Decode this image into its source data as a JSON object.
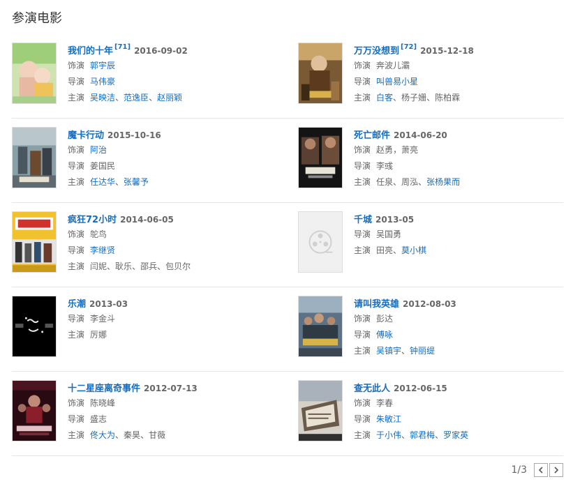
{
  "section": {
    "title": "参演电影"
  },
  "movies": [
    {
      "title": "我们的十年",
      "cite": "[71]",
      "date": "2016-09-02",
      "rows": [
        {
          "label": "饰演",
          "parts": [
            {
              "t": "郭宇辰",
              "link": true
            }
          ]
        },
        {
          "label": "导演",
          "parts": [
            {
              "t": "马伟豪",
              "link": true
            }
          ]
        },
        {
          "label": "主演",
          "parts": [
            {
              "t": "吴映洁",
              "link": true
            },
            {
              "t": "、",
              "link": false
            },
            {
              "t": "范逸臣",
              "link": true
            },
            {
              "t": "、",
              "link": false
            },
            {
              "t": "赵丽颖",
              "link": true
            }
          ]
        }
      ]
    },
    {
      "title": "万万没想到",
      "cite": "[72]",
      "date": "2015-12-18",
      "rows": [
        {
          "label": "饰演",
          "parts": [
            {
              "t": "奔波儿灞",
              "link": false
            }
          ]
        },
        {
          "label": "导演",
          "parts": [
            {
              "t": "叫兽易小星",
              "link": true
            }
          ]
        },
        {
          "label": "主演",
          "parts": [
            {
              "t": "白客",
              "link": true
            },
            {
              "t": "、",
              "link": false
            },
            {
              "t": "杨子姗",
              "link": false
            },
            {
              "t": "、",
              "link": false
            },
            {
              "t": "陈柏霖",
              "link": false
            }
          ]
        }
      ]
    },
    {
      "title": "魔卡行动",
      "cite": "",
      "date": "2015-10-16",
      "rows": [
        {
          "label": "饰演",
          "parts": [
            {
              "t": "阿治",
              "link": true
            }
          ]
        },
        {
          "label": "导演",
          "parts": [
            {
              "t": "姜国民",
              "link": false
            }
          ]
        },
        {
          "label": "主演",
          "parts": [
            {
              "t": "任达华",
              "link": true
            },
            {
              "t": "、",
              "link": false
            },
            {
              "t": "张馨予",
              "link": true
            }
          ]
        }
      ]
    },
    {
      "title": "死亡邮件",
      "cite": "",
      "date": "2014-06-20",
      "rows": [
        {
          "label": "饰演",
          "parts": [
            {
              "t": "赵勇，萧亮",
              "link": false
            }
          ]
        },
        {
          "label": "导演",
          "parts": [
            {
              "t": "李彧",
              "link": false
            }
          ]
        },
        {
          "label": "主演",
          "parts": [
            {
              "t": "任泉",
              "link": false
            },
            {
              "t": "、",
              "link": false
            },
            {
              "t": "周泓",
              "link": false
            },
            {
              "t": "、",
              "link": false
            },
            {
              "t": "张杨果而",
              "link": true
            }
          ]
        }
      ]
    },
    {
      "title": "疯狂72小时",
      "cite": "",
      "date": "2014-06-05",
      "rows": [
        {
          "label": "饰演",
          "parts": [
            {
              "t": "鸵鸟",
              "link": false
            }
          ]
        },
        {
          "label": "导演",
          "parts": [
            {
              "t": "李继贤",
              "link": true
            }
          ]
        },
        {
          "label": "主演",
          "parts": [
            {
              "t": "闫妮",
              "link": false
            },
            {
              "t": "、",
              "link": false
            },
            {
              "t": "耿乐",
              "link": false
            },
            {
              "t": "、",
              "link": false
            },
            {
              "t": "邵兵",
              "link": false
            },
            {
              "t": "、",
              "link": false
            },
            {
              "t": "包贝尔",
              "link": false
            }
          ]
        }
      ]
    },
    {
      "title": "千城",
      "cite": "",
      "date": "2013-05",
      "rows": [
        {
          "label": "导演",
          "parts": [
            {
              "t": "吴国勇",
              "link": false
            }
          ]
        },
        {
          "label": "主演",
          "parts": [
            {
              "t": "田亮",
              "link": false
            },
            {
              "t": "、",
              "link": false
            },
            {
              "t": "莫小棋",
              "link": true
            }
          ]
        }
      ]
    },
    {
      "title": "乐潮",
      "cite": "",
      "date": "2013-03",
      "rows": [
        {
          "label": "导演",
          "parts": [
            {
              "t": "李金斗",
              "link": false
            }
          ]
        },
        {
          "label": "主演",
          "parts": [
            {
              "t": "厉娜",
              "link": false
            }
          ]
        }
      ]
    },
    {
      "title": "请叫我英雄",
      "cite": "",
      "date": "2012-08-03",
      "rows": [
        {
          "label": "饰演",
          "parts": [
            {
              "t": "彭达",
              "link": false
            }
          ]
        },
        {
          "label": "导演",
          "parts": [
            {
              "t": "傅咏",
              "link": true
            }
          ]
        },
        {
          "label": "主演",
          "parts": [
            {
              "t": "吴镇宇",
              "link": true
            },
            {
              "t": "、",
              "link": false
            },
            {
              "t": "钟丽缇",
              "link": true
            }
          ]
        }
      ]
    },
    {
      "title": "十二星座离奇事件",
      "cite": "",
      "date": "2012-07-13",
      "rows": [
        {
          "label": "饰演",
          "parts": [
            {
              "t": "陈晓峰",
              "link": false
            }
          ]
        },
        {
          "label": "导演",
          "parts": [
            {
              "t": "盛志",
              "link": false
            }
          ]
        },
        {
          "label": "主演",
          "parts": [
            {
              "t": "佟大为",
              "link": true
            },
            {
              "t": "、",
              "link": false
            },
            {
              "t": "秦昊",
              "link": false
            },
            {
              "t": "、",
              "link": false
            },
            {
              "t": "甘薇",
              "link": false
            }
          ]
        }
      ]
    },
    {
      "title": "查无此人",
      "cite": "",
      "date": "2012-06-15",
      "rows": [
        {
          "label": "饰演",
          "parts": [
            {
              "t": "李春",
              "link": false
            }
          ]
        },
        {
          "label": "导演",
          "parts": [
            {
              "t": "朱敏江",
              "link": true
            }
          ]
        },
        {
          "label": "主演",
          "parts": [
            {
              "t": "于小伟",
              "link": true
            },
            {
              "t": "、",
              "link": false
            },
            {
              "t": "郭君梅",
              "link": true
            },
            {
              "t": "、",
              "link": false
            },
            {
              "t": "罗家英",
              "link": true
            }
          ]
        }
      ]
    }
  ],
  "pager": {
    "count": "1/3"
  },
  "colors": {
    "link": "#136ec2",
    "muted": "#666666",
    "divider": "#e5e5e5"
  }
}
